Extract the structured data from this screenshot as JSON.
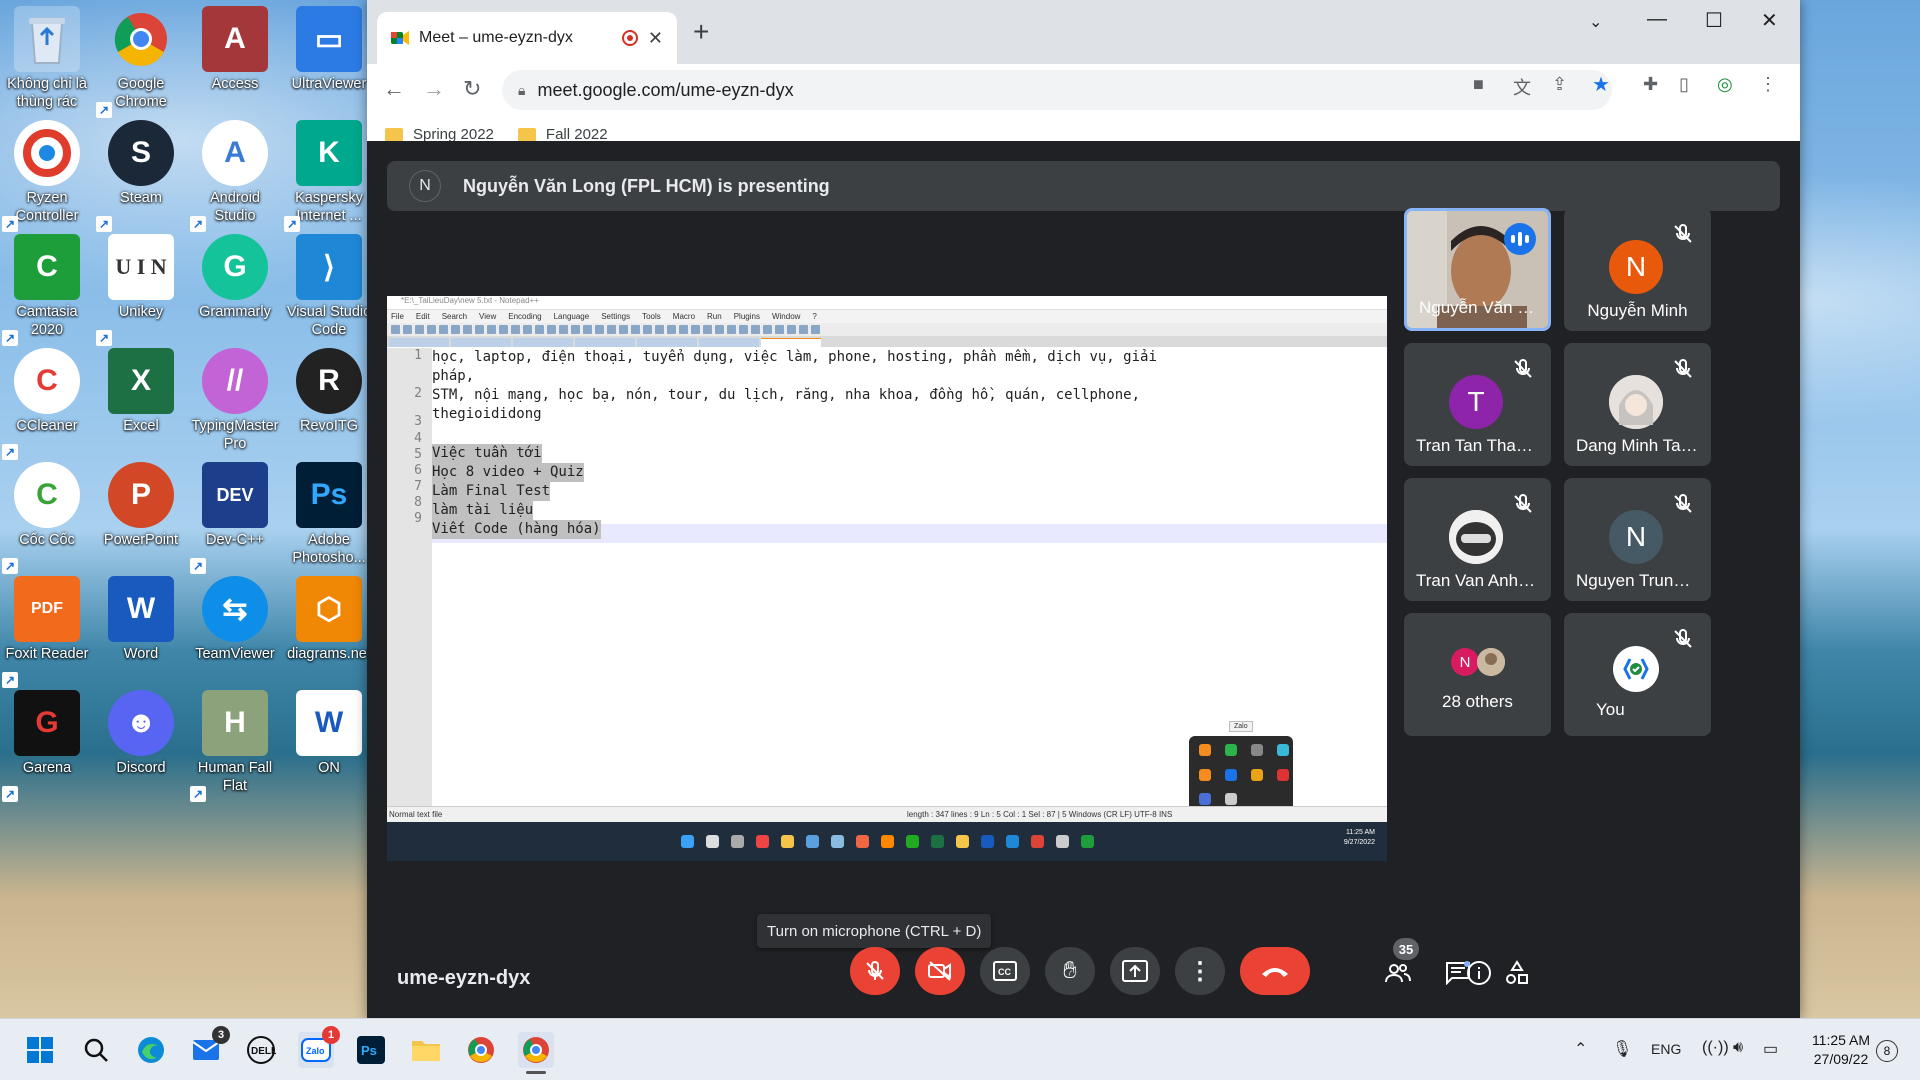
{
  "desktop": {
    "icons": [
      {
        "label": "Không chỉ là thùng rác"
      },
      {
        "label": "Google Chrome"
      },
      {
        "label": "Access"
      },
      {
        "label": "UltraViewer"
      },
      {
        "label": "Ryzen Controller"
      },
      {
        "label": "Steam"
      },
      {
        "label": "Android Studio"
      },
      {
        "label": "Kaspersky Internet ..."
      },
      {
        "label": "Camtasia 2020"
      },
      {
        "label": "Unikey"
      },
      {
        "label": "Grammarly"
      },
      {
        "label": "Visual Studio Code"
      },
      {
        "label": "CCleaner"
      },
      {
        "label": "Excel"
      },
      {
        "label": "TypingMaster Pro"
      },
      {
        "label": "RevoITG"
      },
      {
        "label": "Cốc Cốc"
      },
      {
        "label": "PowerPoint"
      },
      {
        "label": "Dev-C++"
      },
      {
        "label": "Adobe Photosho..."
      },
      {
        "label": "Foxit Reader"
      },
      {
        "label": "Word"
      },
      {
        "label": "TeamViewer"
      },
      {
        "label": "diagrams.net"
      },
      {
        "label": "Garena"
      },
      {
        "label": "Discord"
      },
      {
        "label": "Human Fall Flat"
      },
      {
        "label": "ON"
      }
    ]
  },
  "browser": {
    "tab_title": "Meet – ume-eyzn-dyx",
    "new_tab": "+",
    "url": "meet.google.com/ume-eyzn-dyx",
    "bookmarks": [
      {
        "label": "Spring 2022"
      },
      {
        "label": "Fall 2022"
      }
    ]
  },
  "meet": {
    "presenter_initial": "N",
    "presenting_text": "Nguyễn Văn Long (FPL HCM) is presenting",
    "meeting_code": "ume-eyzn-dyx",
    "tooltip": "Turn on microphone (CTRL + D)",
    "people_count": "35",
    "participants": [
      {
        "name": "Nguyễn Văn Lo...",
        "initial": "",
        "color": ""
      },
      {
        "name": "Nguyễn Minh",
        "initial": "N",
        "color": "#e8590c"
      },
      {
        "name": "Tran Tan Thanh ...",
        "initial": "T",
        "color": "#8e24aa"
      },
      {
        "name": "Dang Minh Tai (...",
        "initial": "",
        "color": ""
      },
      {
        "name": "Tran Van Anh (...",
        "initial": "",
        "color": ""
      },
      {
        "name": "Nguyen Trung ...",
        "initial": "N",
        "color": "#455a64"
      },
      {
        "name": "28 others",
        "initial": "N",
        "color": "#d81b60"
      },
      {
        "name": "You",
        "initial": "",
        "color": ""
      }
    ]
  },
  "shared_screen": {
    "window_title": "*E:\\_TaiLieuDay\\new 5.txt - Notepad++",
    "menu": [
      "File",
      "Edit",
      "Search",
      "View",
      "Encoding",
      "Language",
      "Settings",
      "Tools",
      "Macro",
      "Run",
      "Plugins",
      "Window",
      "?"
    ],
    "lines": [
      {
        "num": "1",
        "text": "học, laptop, điện thoại, tuyển dụng, việc làm, phone, hosting, phần mềm, dịch vụ, giải"
      },
      {
        "num": "",
        "text": "pháp,"
      },
      {
        "num": "2",
        "text": "STM, nội mạng, học bạ, nón, tour, du lịch, răng, nha khoa, đồng hồ, quán, cellphone,"
      },
      {
        "num": "",
        "text": "thegioididong"
      },
      {
        "num": "3",
        "text": ""
      },
      {
        "num": "4",
        "text": ""
      },
      {
        "num": "5",
        "text": "Việc tuần tới"
      },
      {
        "num": "6",
        "text": "Học 8 video + Quiz"
      },
      {
        "num": "7",
        "text": "Làm Final Test"
      },
      {
        "num": "8",
        "text": "làm tài liệu"
      },
      {
        "num": "9",
        "text": "Viết Code (hàng hóa)"
      }
    ],
    "status_left": "Normal text file",
    "status_right": "length : 347    lines : 9          Ln : 5    Col : 1    Sel : 87 | 5             Windows (CR LF)    UTF-8          INS",
    "zalo_tip": "Zalo",
    "inner_time": "11:25 AM",
    "inner_date": "9/27/2022"
  },
  "taskbar": {
    "lang": "ENG",
    "time": "11:25 AM",
    "date": "27/09/22",
    "notifications": "8",
    "mail_badge": "3",
    "zalo_badge": "1"
  },
  "colors": {
    "meet_bg": "#202124",
    "tile_bg": "#3c4043",
    "danger": "#ea4335",
    "accent": "#1a73e8"
  }
}
